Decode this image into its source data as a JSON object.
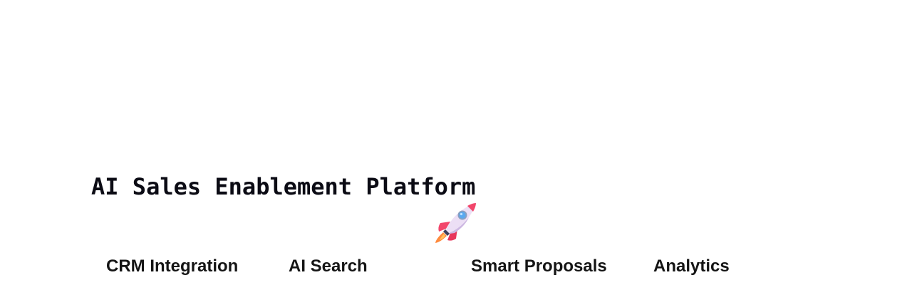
{
  "header": {
    "title": "AI Sales Enablement Platform"
  },
  "hero": {
    "icon": "rocket-icon"
  },
  "features": [
    {
      "label": "CRM Integration"
    },
    {
      "label": "AI Search"
    },
    {
      "label": "Smart Proposals"
    },
    {
      "label": "Analytics"
    }
  ],
  "colors": {
    "background": "#ffffff",
    "text": "#151515",
    "rocket_body": "#ecdff5",
    "rocket_fin": "#f2466b",
    "rocket_window": "#5aa9f0",
    "rocket_flame": "#ff8a3d"
  }
}
